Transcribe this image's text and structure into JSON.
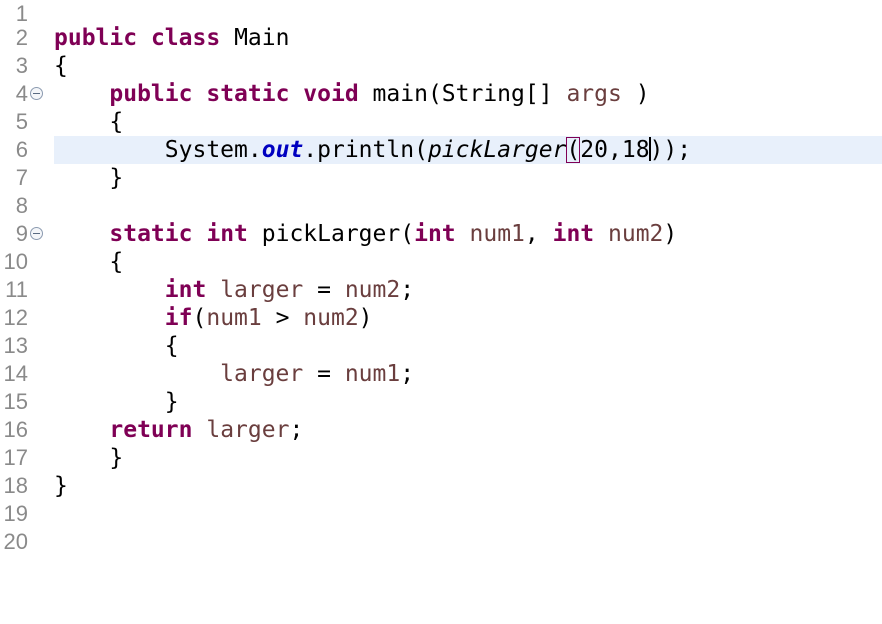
{
  "editor": {
    "line_numbers": [
      "1",
      "2",
      "3",
      "4",
      "5",
      "6",
      "7",
      "8",
      "9",
      "10",
      "11",
      "12",
      "13",
      "14",
      "15",
      "16",
      "17",
      "18",
      "19",
      "20"
    ],
    "current_line": "6",
    "tokens": {
      "public": "public",
      "class": "class",
      "static": "static",
      "void": "void",
      "int": "int",
      "if": "if",
      "return": "return",
      "class_name": "Main",
      "main_method": "main",
      "string_type": "String",
      "array_brackets": "[]",
      "args": "args",
      "system": "System",
      "dot": ".",
      "out": "out",
      "println": "println",
      "pick_larger": "pickLarger",
      "open_paren": "(",
      "close_paren": ")",
      "arg1": "20",
      "comma": ",",
      "arg2": "18",
      "close_parens_semicolon": "));",
      "open_brace": "{",
      "close_brace": "}",
      "num1": "num1",
      "num2": "num2",
      "larger": "larger",
      "assign": " = ",
      "semicolon": ";",
      "greater": " > ",
      "comma_space": ", "
    }
  }
}
